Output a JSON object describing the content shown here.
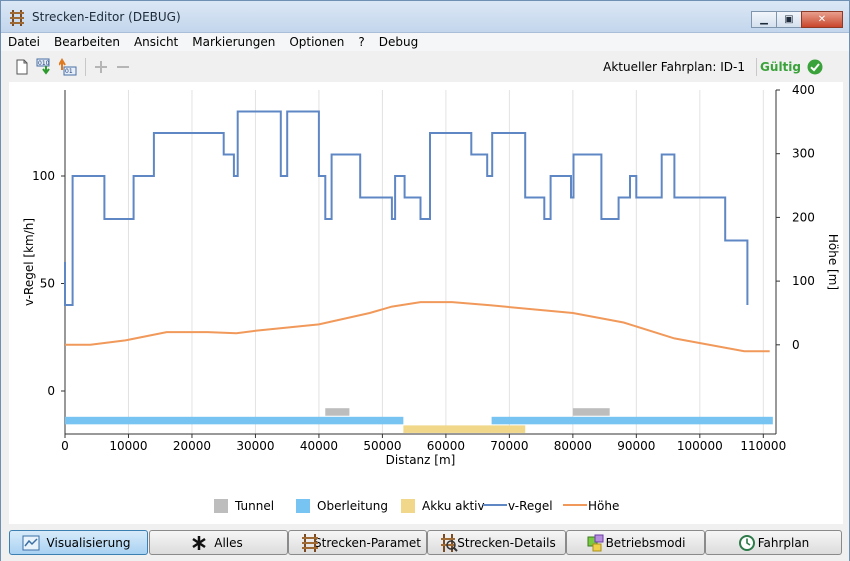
{
  "window": {
    "title": "Strecken-Editor (DEBUG)"
  },
  "menu": [
    "Datei",
    "Bearbeiten",
    "Ansicht",
    "Markierungen",
    "Optionen",
    "?",
    "Debug"
  ],
  "toolbar": {
    "status_text": "Aktueller Fahrplan: ID-1",
    "valid_label": "Gültig"
  },
  "tabs": [
    {
      "label": "Visualisierung",
      "icon": "chart-icon",
      "active": true
    },
    {
      "label": "Alles",
      "icon": "asterisk-icon",
      "active": false
    },
    {
      "label": "Strecken-Paramet",
      "icon": "track-icon",
      "active": false
    },
    {
      "label": "Strecken-Details",
      "icon": "track-details-icon",
      "active": false
    },
    {
      "label": "Betriebsmodi",
      "icon": "modes-icon",
      "active": false
    },
    {
      "label": "Fahrplan",
      "icon": "clock-icon",
      "active": false
    }
  ],
  "colors": {
    "v_regel": "#5f87c4",
    "hoehe": "#f1995a",
    "tunnel": "#bdbdbd",
    "oberleitung": "#77c4f2",
    "akku": "#f0d78a",
    "valid": "#3aa23a"
  },
  "chart_data": {
    "type": "line",
    "xlabel": "Distanz [m]",
    "ylabel": "v-Regel [km/h]",
    "y2label": "Höhe [m]",
    "xlim": [
      0,
      112000
    ],
    "ylim": [
      -20,
      140
    ],
    "y2lim": [
      -140,
      400
    ],
    "xticks": [
      0,
      10000,
      20000,
      30000,
      40000,
      50000,
      60000,
      70000,
      80000,
      90000,
      100000,
      110000
    ],
    "yticks": [
      0,
      50,
      100
    ],
    "y2ticks": [
      0,
      100,
      200,
      300,
      400
    ],
    "grid": "vertical",
    "legend": [
      "Tunnel",
      "Oberleitung",
      "Akku aktiv",
      "v-Regel",
      "Höhe"
    ],
    "legend_placement": "bottom",
    "v_regel": {
      "x": [
        0,
        0,
        1200,
        1200,
        6200,
        6200,
        10800,
        10800,
        14000,
        14000,
        25000,
        25000,
        26600,
        26600,
        27200,
        27200,
        34000,
        34000,
        35000,
        35000,
        40000,
        40000,
        41000,
        41000,
        42000,
        42000,
        46500,
        46500,
        51500,
        51500,
        52000,
        52000,
        53500,
        53500,
        56000,
        56000,
        57500,
        57500,
        64000,
        64000,
        66500,
        66500,
        67300,
        67300,
        72500,
        72500,
        75500,
        75500,
        76500,
        76500,
        79700,
        79700,
        80100,
        80100,
        84500,
        84500,
        87200,
        87200,
        89000,
        89000,
        90000,
        90000,
        94000,
        94000,
        96000,
        96000,
        104000,
        104000,
        107500,
        107500,
        111000,
        111000
      ],
      "y": [
        60,
        40,
        40,
        100,
        100,
        80,
        80,
        100,
        100,
        120,
        120,
        110,
        110,
        100,
        100,
        130,
        130,
        100,
        100,
        130,
        130,
        100,
        100,
        80,
        80,
        110,
        110,
        90,
        90,
        80,
        80,
        100,
        100,
        90,
        90,
        80,
        80,
        120,
        120,
        110,
        110,
        100,
        100,
        120,
        120,
        90,
        90,
        80,
        80,
        100,
        100,
        90,
        90,
        110,
        110,
        80,
        80,
        90,
        90,
        100,
        100,
        90,
        90,
        110,
        110,
        90,
        90,
        70,
        70,
        40
      ]
    },
    "hoehe": {
      "x": [
        0,
        4000,
        9500,
        16000,
        22500,
        27000,
        30000,
        40000,
        48000,
        51500,
        56000,
        61000,
        67000,
        80000,
        88000,
        96000,
        107000,
        111000
      ],
      "y": [
        0,
        0,
        7,
        20,
        20,
        18,
        22,
        32,
        50,
        60,
        67,
        67,
        62,
        50,
        35,
        10,
        -10,
        -10
      ]
    },
    "tunnel": [
      [
        41000,
        44800
      ],
      [
        80000,
        85800
      ]
    ],
    "oberleitung": [
      [
        0,
        53300
      ],
      [
        67200,
        111500
      ]
    ],
    "akku_aktiv": [
      [
        53300,
        72500
      ]
    ]
  }
}
